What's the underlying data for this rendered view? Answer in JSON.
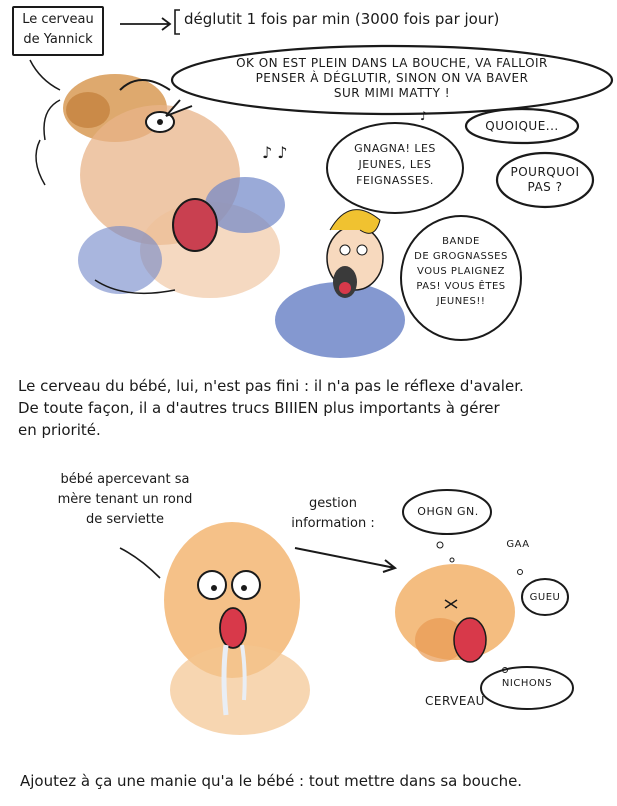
{
  "panel1": {
    "label_line1": "Le cerveau",
    "label_line2": "de Yannick",
    "note": "déglutit 1 fois par min (3000 fois par jour)",
    "speech_main_l1": "OK ON EST PLEIN DANS LA BOUCHE, VA FALLOIR",
    "speech_main_l2": "PENSER À DÉGLUTIR, SINON ON VA BAVER",
    "speech_main_l3": "SUR MIMI MATTY !",
    "speech_quoique": "QUOIQUE...",
    "speech_pourquoi_l1": "POURQUOI",
    "speech_pourquoi_l2": "PAS ?",
    "thought_gnagna_l1": "GNAGNA! LES",
    "thought_gnagna_l2": "JEUNES, LES",
    "thought_gnagna_l3": "FEIGNASSES.",
    "thought_bande_l1": "BANDE",
    "thought_bande_l2": "DE GROGNASSES",
    "thought_bande_l3": "VOUS PLAIGNEZ",
    "thought_bande_l4": "PAS! VOUS ÊTES",
    "thought_bande_l5": "JEUNES!!"
  },
  "narration1_l1": "Le cerveau du bébé, lui, n'est pas fini : il n'a pas le réflexe d'avaler.",
  "narration1_l2": "De toute façon, il a d'autres trucs BIIIEN plus importants à gérer",
  "narration1_l3": "en priorité.",
  "panel2": {
    "caption_l1": "bébé apercevant sa",
    "caption_l2": "mère tenant un rond",
    "caption_l3": "de serviette",
    "gestion_l1": "gestion",
    "gestion_l2": "information :",
    "thought_ohgn": "OHGN GN.",
    "thought_gaa": "GAA",
    "thought_gueu": "GUEU",
    "thought_nichons": "NICHONS",
    "cerveau_label": "CERVEAU"
  },
  "narration2": "Ajoutez à ça une manie qu'a le bébé : tout mettre dans sa bouche.",
  "colors": {
    "ink": "#1a1a1a",
    "skin": "#e8b48a",
    "hair_brown": "#c48a4a",
    "shirt_blue": "#6f86c8",
    "hair_yellow": "#f0c230",
    "baby_orange": "#f2b26a",
    "mouth_red": "#d8394a"
  }
}
